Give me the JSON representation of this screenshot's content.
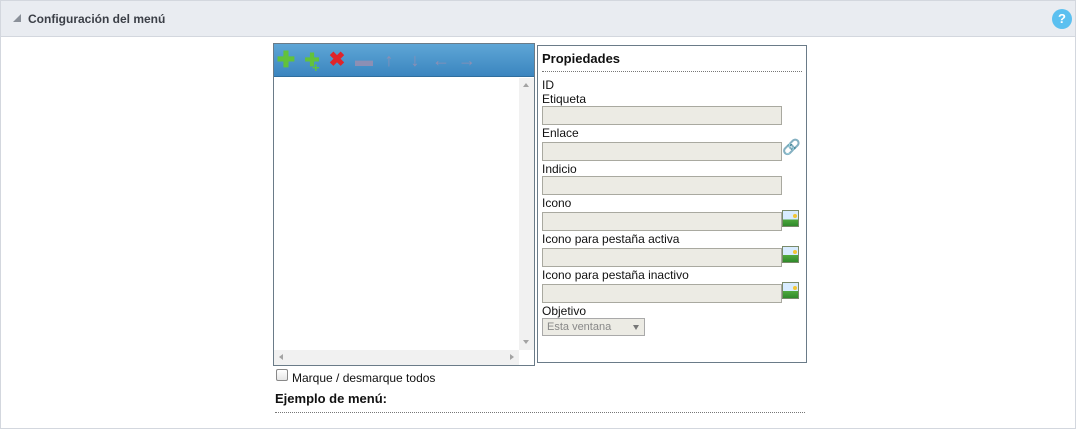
{
  "panel": {
    "title": "Configuración del menú",
    "help_label": "?"
  },
  "toolbar": {
    "buttons": [
      {
        "name": "add",
        "glyph": "✚"
      },
      {
        "name": "add-sub",
        "glyph": "✚"
      },
      {
        "name": "delete",
        "glyph": "✖"
      },
      {
        "name": "separator",
        "glyph": "▬"
      },
      {
        "name": "move-up",
        "glyph": "↑"
      },
      {
        "name": "move-down",
        "glyph": "↓"
      },
      {
        "name": "move-left",
        "glyph": "←"
      },
      {
        "name": "move-right",
        "glyph": "→"
      }
    ]
  },
  "properties": {
    "title": "Propiedades",
    "id_label": "ID",
    "etiqueta_label": "Etiqueta",
    "etiqueta_value": "",
    "enlace_label": "Enlace",
    "enlace_value": "",
    "indicio_label": "Indicio",
    "indicio_value": "",
    "icono_label": "Icono",
    "icono_value": "",
    "icono_activa_label": "Icono para pestaña activa",
    "icono_activa_value": "",
    "icono_inactivo_label": "Icono para pestaña inactivo",
    "icono_inactivo_value": "",
    "objetivo_label": "Objetivo",
    "objetivo_selected": "Esta ventana"
  },
  "footer": {
    "check_all_label": "Marque / desmarque todos",
    "example_title": "Ejemplo de menú:"
  },
  "colors": {
    "header_bg": "#e9ecf1",
    "toolbar_bg": "#3b85bf",
    "help_bg": "#5bc0f0",
    "add_green": "#62c23a",
    "delete_red": "#e0242a",
    "field_bg": "#ecebe4"
  }
}
